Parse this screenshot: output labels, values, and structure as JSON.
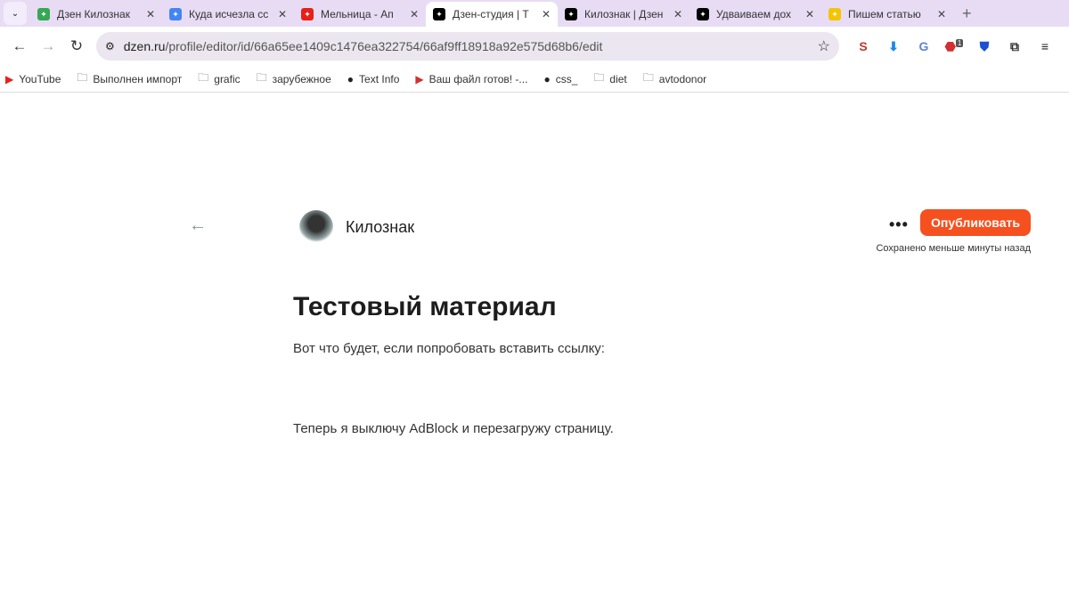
{
  "tabs": [
    {
      "title": "Дзен Килознак",
      "icon": "google-drive-icon",
      "color": "#34a853"
    },
    {
      "title": "Куда исчезла сс",
      "icon": "google-docs-icon",
      "color": "#4285f4"
    },
    {
      "title": "Мельница - Ап",
      "icon": "youtube-icon",
      "color": "#e62117"
    },
    {
      "title": "Дзен-студия | Т",
      "icon": "dzen-icon",
      "color": "#000000",
      "active": true
    },
    {
      "title": "Килознак | Дзен",
      "icon": "dzen-icon",
      "color": "#000000"
    },
    {
      "title": "Удваиваем дох",
      "icon": "dzen-icon",
      "color": "#000000"
    },
    {
      "title": "Пишем статью",
      "icon": "play-icon",
      "color": "#f5c400"
    }
  ],
  "address": {
    "host": "dzen.ru",
    "path": "/profile/editor/id/66a65ee1409c1476ea322754/66af9ff18918a92e575d68b6/edit"
  },
  "extensions": [
    {
      "icon": "seo-extension-icon",
      "badge": ""
    },
    {
      "icon": "download-extension-icon",
      "badge": ""
    },
    {
      "icon": "translate-extension-icon",
      "badge": ""
    },
    {
      "icon": "adblock-extension-icon",
      "badge": "1"
    },
    {
      "icon": "shield-extension-icon",
      "badge": ""
    },
    {
      "icon": "puzzle-icon",
      "badge": ""
    }
  ],
  "bookmarks": [
    {
      "label": "YouTube",
      "icon": "youtube-icon"
    },
    {
      "label": "Выполнен импорт",
      "icon": "folder-icon"
    },
    {
      "label": "grafic",
      "icon": "folder-icon"
    },
    {
      "label": "зарубежное",
      "icon": "folder-icon"
    },
    {
      "label": "Text Info",
      "icon": "globe-icon"
    },
    {
      "label": "Ваш файл готов! -...",
      "icon": "video-icon"
    },
    {
      "label": "css_",
      "icon": "globe-icon"
    },
    {
      "label": "diet",
      "icon": "folder-icon"
    },
    {
      "label": "avtodonor",
      "icon": "folder-icon"
    }
  ],
  "editor": {
    "channel_name": "Килознак",
    "publish_label": "Опубликовать",
    "saved_status": "Сохранено меньше минуты назад",
    "title": "Тестовый материал",
    "paragraphs": [
      "Вот что будет, если попробовать вставить ссылку:",
      "Теперь я выключу AdBlock и перезагружу страницу."
    ],
    "accent": "#f5501e"
  }
}
